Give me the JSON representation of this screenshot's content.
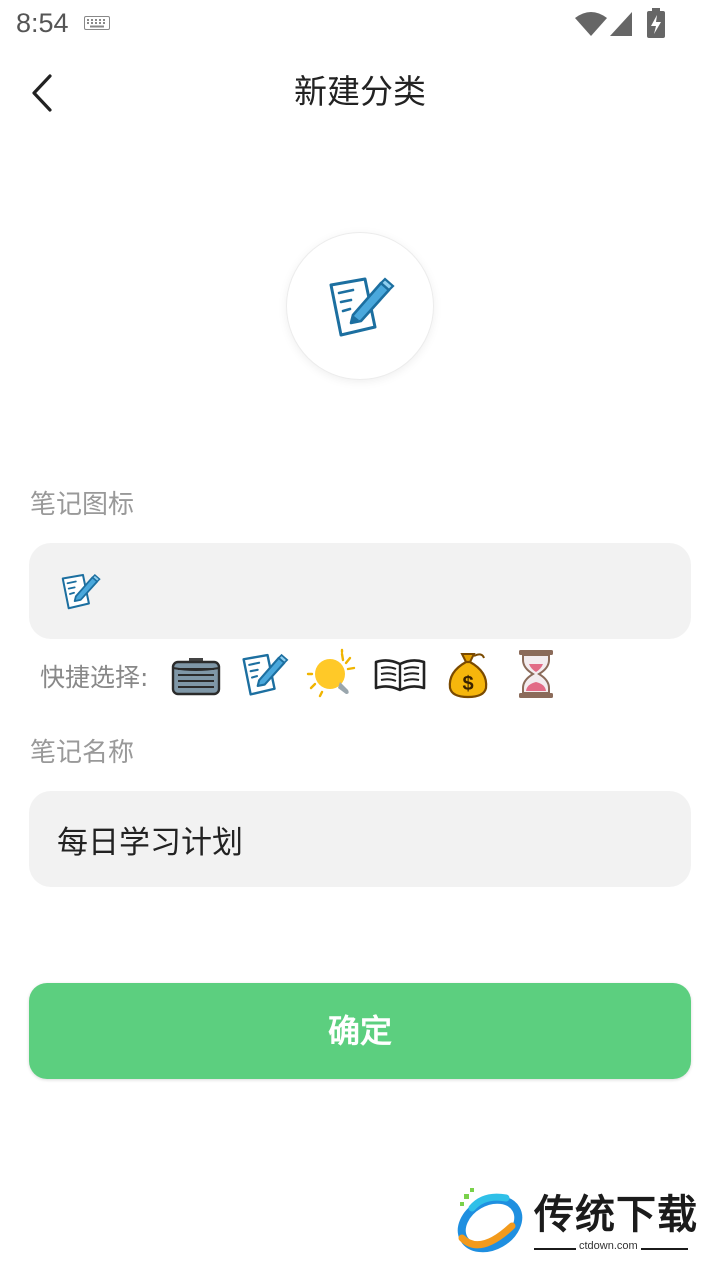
{
  "status_bar": {
    "time": "8:54",
    "icons": [
      "keyboard-icon",
      "wifi-icon",
      "signal-icon",
      "battery-charging-icon"
    ]
  },
  "header": {
    "title": "新建分类",
    "back_icon": "chevron-left-icon"
  },
  "preview": {
    "icon": "memo-pencil-icon"
  },
  "icon_section": {
    "label": "笔记图标",
    "selected_icon": "memo-pencil-icon"
  },
  "quick_select": {
    "label": "快捷选择:",
    "options": [
      "briefcase-icon",
      "memo-pencil-icon",
      "lightbulb-icon",
      "open-book-icon",
      "money-bag-icon",
      "hourglass-icon"
    ]
  },
  "name_section": {
    "label": "笔记名称",
    "value": "每日学习计划"
  },
  "confirm_button": {
    "label": "确定"
  },
  "colors": {
    "accent_green": "#5ccf7f",
    "field_bg": "#f2f2f2",
    "label_gray": "#999999"
  },
  "watermark": {
    "brand": "传统下载",
    "url": "ctdown.com"
  }
}
